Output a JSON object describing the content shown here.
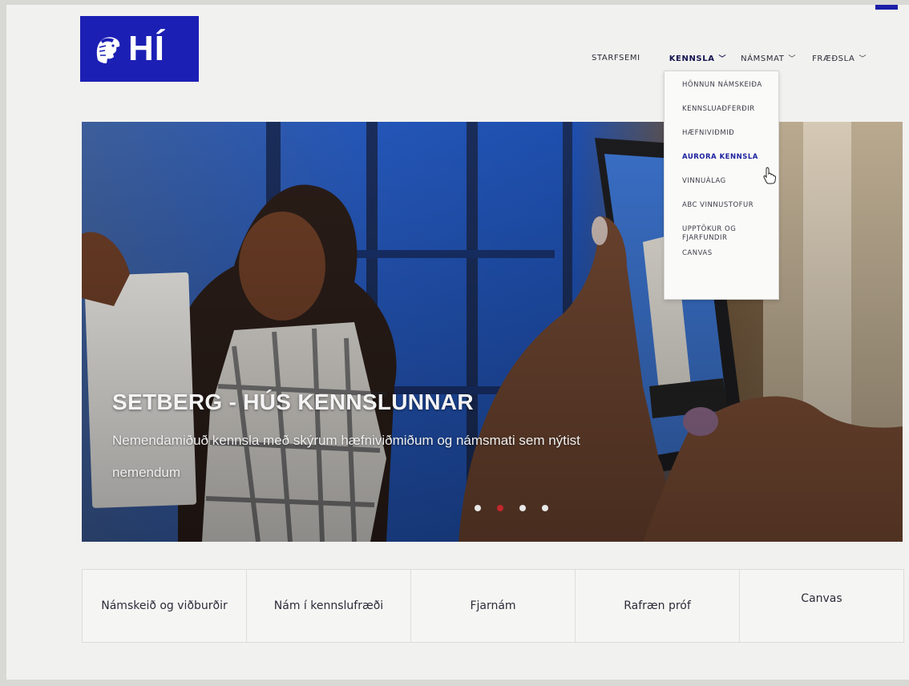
{
  "logo": {
    "text": "HÍ",
    "brand_color": "#1c1fb4"
  },
  "nav": {
    "items": [
      {
        "label": "STARFSEMI",
        "has_dropdown": false
      },
      {
        "label": "KENNSLA",
        "has_dropdown": true,
        "active": true
      },
      {
        "label": "NÁMSMAT",
        "has_dropdown": true
      },
      {
        "label": "FRÆÐSLA",
        "has_dropdown": true
      }
    ],
    "chevron": "chevron-down-icon"
  },
  "dropdown": {
    "items": [
      "HÖNNUN NÁMSKEIÐA",
      "KENNSLUAÐFERÐIR",
      "HÆFNIVIÐMIÐ",
      "AURORA KENNSLA",
      "VINNUÁLAG",
      "ABC VINNUSTOFUR",
      "UPPTÖKUR OG FJARFUNDIR",
      "CANVAS"
    ],
    "hovered_index": 3,
    "hover_color": "#1a1f9e"
  },
  "hero": {
    "title": "SETBERG - HÚS KENNSLUNNAR",
    "subtitle": "Nemendamiðuð kennsla með skýrum hæfniviðmiðum og námsmati sem nýtist nemendum",
    "slides": 4,
    "active_slide": 1,
    "active_dot_color": "#c4272b"
  },
  "quick_links": [
    "Námskeið og viðburðir",
    "Nám í kennslufræði",
    "Fjarnám",
    "Rafræn próf",
    "Canvas"
  ]
}
